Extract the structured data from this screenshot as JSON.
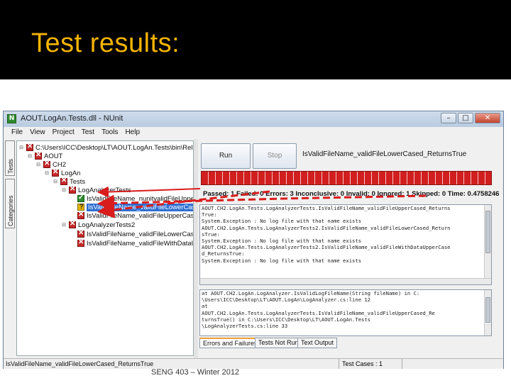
{
  "slide": {
    "title": "Test results:",
    "footer": "SENG 403 – Winter 2012"
  },
  "window": {
    "title": "AOUT.LogAn.Tests.dll - NUnit",
    "minimize": "–",
    "maximize": "□",
    "close": "✕"
  },
  "menu": [
    "File",
    "View",
    "Project",
    "Test",
    "Tools",
    "Help"
  ],
  "side_tabs": {
    "tests": "Tests",
    "categories": "Categories"
  },
  "tree": [
    {
      "expander": "⊟",
      "status": "fail",
      "label": "C:\\Users\\ICC\\Desktop\\LT\\AOUT.LogAn.Tests\\bin\\Release"
    },
    {
      "expander": "⊟",
      "status": "fail",
      "label": "AOUT"
    },
    {
      "expander": "⊟",
      "status": "fail",
      "label": "CH2"
    },
    {
      "expander": "⊟",
      "status": "fail",
      "label": "LogAn"
    },
    {
      "expander": "⊟",
      "status": "fail",
      "label": "Tests"
    },
    {
      "expander": "⊟",
      "status": "fail",
      "label": "LogAnalyzerTests"
    },
    {
      "expander": "",
      "status": "pass",
      "label": "IsValidFileName_nunitvalidFileUpper"
    },
    {
      "expander": "",
      "status": "warn",
      "label": "IsValidFileName_validFileLowerCase"
    },
    {
      "expander": "",
      "status": "fail",
      "label": "IsValidFileName_validFileUpperCase"
    },
    {
      "expander": "⊟",
      "status": "fail",
      "label": "LogAnalyzerTests2"
    },
    {
      "expander": "",
      "status": "fail",
      "label": "IsValidFileName_validFileLowerCase"
    },
    {
      "expander": "",
      "status": "fail",
      "label": "IsValidFileName_validFileWithDataU"
    }
  ],
  "toolbar": {
    "run_label": "Run",
    "stop_label": "Stop",
    "current_test": "IsValidFileName_validFileLowerCased_ReturnsTrue"
  },
  "results_summary": "Passed: 1   Failed: 0   Errors: 3   Inconclusive: 0   Invalid: 0   Ignored: 1   Skipped: 0   Time: 0.4758246",
  "errors_text": [
    "AOUT.CH2.LogAn.Tests.LogAnalyzerTests.IsValidFileName_validFileUpperCased_Returns",
    "True:",
    "System.Exception : No log file with that name exists",
    "AOUT.CH2.LogAn.Tests.LogAnalyzerTests2.IsValidFileName_validFileLowerCased_Return",
    "sTrue:",
    "System.Exception : No log file with that name exists",
    "AOUT.CH2.LogAn.Tests.LogAnalyzerTests2.IsValidFileName_validFileWithDataUpperCase",
    "d_ReturnsTrue:",
    "System.Exception : No log file with that name exists"
  ],
  "stacktrace_text": [
    "at AOUT.CH2.LogAn.LogAnalyzer.IsValidLogFileName(String fileName) in C:",
    "\\Users\\ICC\\Desktop\\LT\\AOUT.LogAn\\LogAnalyzer.cs:line 12",
    "at",
    "AOUT.CH2.LogAn.Tests.LogAnalyzerTests.IsValidFileName_validFileUpperCased_Re",
    "turnsTrue() in C:\\Users\\ICC\\Desktop\\LT\\AOUT.LogAn.Tests",
    "\\LogAnalyzerTests.cs:line 33"
  ],
  "bottom_tabs": {
    "errors": "Errors and Failures",
    "not_run": "Tests Not Run",
    "output": "Text Output"
  },
  "status": {
    "text": "IsValidFileName_validFileLowerCased_ReturnsTrue",
    "test_cases": "Test Cases : 1"
  },
  "colors": {
    "title": "#f4b400",
    "progress_fail": "#d11f1f",
    "annotation_arrow": "#d91c1c"
  }
}
